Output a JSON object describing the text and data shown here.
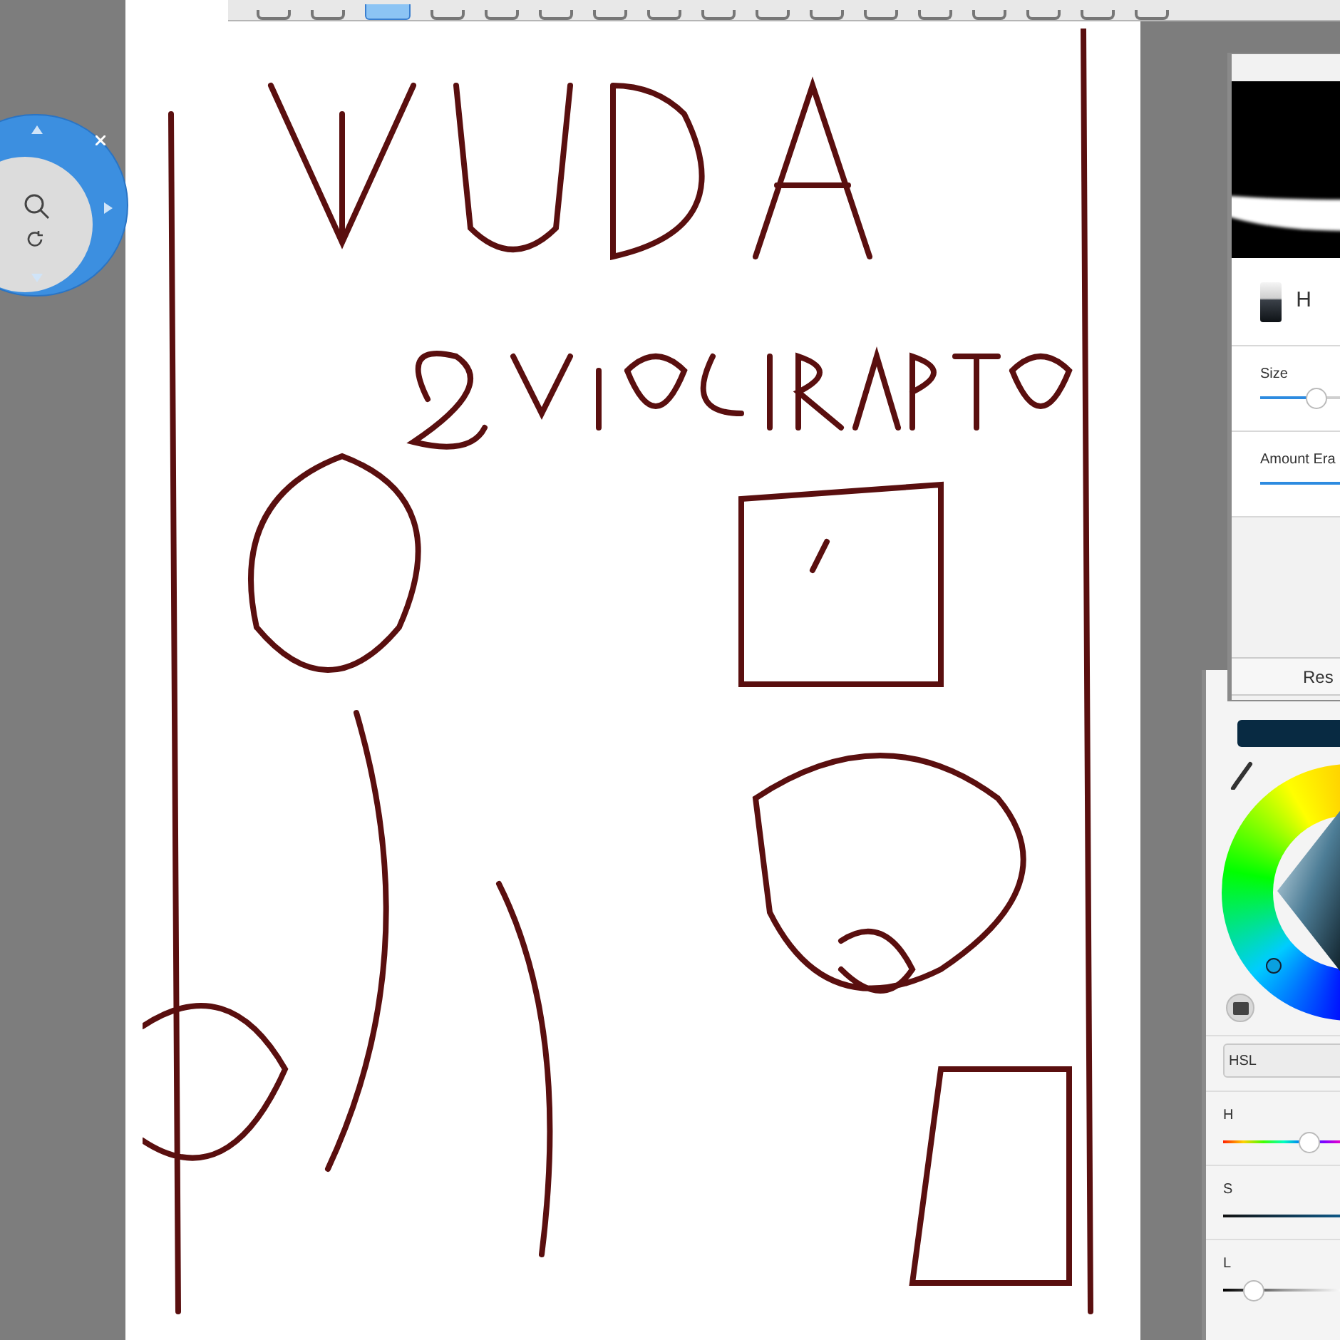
{
  "toolbar": {
    "tools": [
      {
        "selected": false
      },
      {
        "selected": false
      },
      {
        "selected": true
      },
      {
        "selected": false
      },
      {
        "selected": false
      },
      {
        "selected": false
      },
      {
        "selected": false
      },
      {
        "selected": false
      },
      {
        "selected": false
      },
      {
        "selected": false
      },
      {
        "selected": false
      },
      {
        "selected": false
      },
      {
        "selected": false
      },
      {
        "selected": false
      },
      {
        "selected": false
      },
      {
        "selected": false
      },
      {
        "selected": false
      }
    ]
  },
  "brush_panel": {
    "brush_name": "H",
    "sliders": [
      {
        "label": "Size",
        "level": 0.7,
        "kind": "thumb"
      },
      {
        "label": "Amount Era",
        "level": 1,
        "kind": "bar"
      }
    ],
    "reset": "Res"
  },
  "color_panel": {
    "mode": "HSL",
    "sliders": [
      {
        "label": "H",
        "level": 0.7,
        "kind": "hue"
      },
      {
        "label": "S",
        "level": 1,
        "kind": "saturation"
      },
      {
        "label": "L",
        "level": 0.25,
        "kind": "lightness"
      }
    ]
  }
}
